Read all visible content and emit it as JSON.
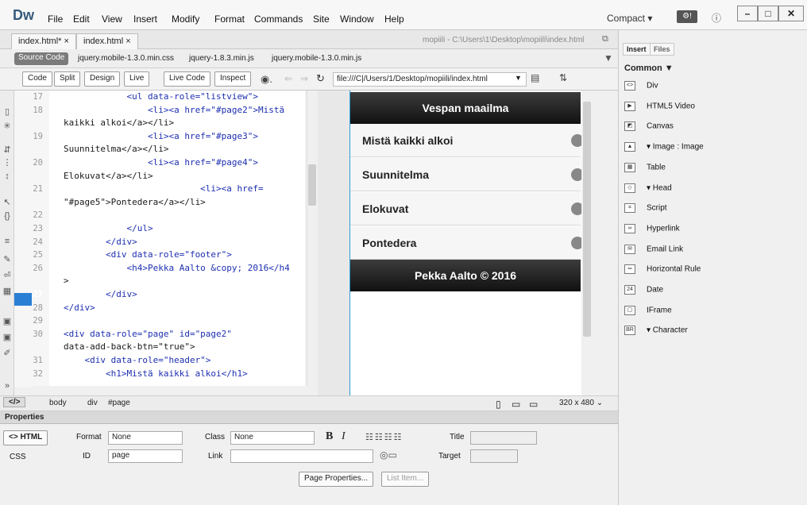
{
  "app": {
    "logo": "Dw",
    "menus": [
      "File",
      "Edit",
      "View",
      "Insert",
      "Modify",
      "Format",
      "Commands",
      "Site",
      "Window",
      "Help"
    ],
    "workspace": "Compact ▾",
    "gear": "⚙"
  },
  "tabs": [
    {
      "label": "index.html*  ×"
    },
    {
      "label": "index.html  ×"
    }
  ],
  "path": "mopiili - C:\\Users\\1\\Desktop\\mopiili\\index.html",
  "related": {
    "source": "Source Code",
    "files": [
      "jquery.mobile-1.3.0.min.css",
      "jquery-1.8.3.min.js",
      "jquery.mobile-1.3.0.min.js"
    ]
  },
  "toolbar": {
    "code": "Code",
    "split": "Split",
    "design": "Design",
    "live": "Live",
    "livecode": "Live Code",
    "inspect": "Inspect",
    "address": "file:///C|/Users/1/Desktop/mopiili/index.html"
  },
  "code": {
    "lines": [
      {
        "n": "17",
        "t": "            <ul data-role=\"listview\">"
      },
      {
        "n": "18",
        "t": "                <li><a href=\"#page2\">Mistä"
      },
      {
        "n": "",
        "t": "kaikki alkoi</a></li>"
      },
      {
        "n": "19",
        "t": "                <li><a href=\"#page3\">"
      },
      {
        "n": "",
        "t": "Suunnitelma</a></li>"
      },
      {
        "n": "20",
        "t": "                <li><a href=\"#page4\">"
      },
      {
        "n": "",
        "t": "Elokuvat</a></li>"
      },
      {
        "n": "21",
        "t": "                          <li><a href="
      },
      {
        "n": "",
        "t": "\"#page5\">Pontedera</a></li>"
      },
      {
        "n": "22",
        "t": ""
      },
      {
        "n": "23",
        "t": "            </ul>"
      },
      {
        "n": "24",
        "t": "        </div>"
      },
      {
        "n": "25",
        "t": "        <div data-role=\"footer\">"
      },
      {
        "n": "26",
        "t": "            <h4>Pekka Aalto &copy; 2016</h4"
      },
      {
        "n": "",
        "t": ">"
      },
      {
        "n": "27",
        "t": "        </div>"
      },
      {
        "n": "28",
        "t": "</div>"
      },
      {
        "n": "29",
        "t": ""
      },
      {
        "n": "30",
        "t": "<div data-role=\"page\" id=\"page2\""
      },
      {
        "n": "",
        "t": "data-add-back-btn=\"true\">"
      },
      {
        "n": "31",
        "t": "    <div data-role=\"header\">"
      },
      {
        "n": "32",
        "t": "        <h1>Mistä kaikki alkoi</h1>"
      }
    ]
  },
  "live": {
    "header": "Vespan maailma",
    "items": [
      "Mistä kaikki alkoi",
      "Suunnitelma",
      "Elokuvat",
      "Pontedera"
    ],
    "footer": "Pekka Aalto © 2016"
  },
  "status": {
    "tag": "</>",
    "crumbs": [
      "body",
      "div",
      "#page"
    ],
    "size": "320 x 480 ⌄"
  },
  "properties": {
    "title": "Properties",
    "html": "<> HTML",
    "css": "CSS",
    "format_label": "Format",
    "format": "None",
    "class_label": "Class",
    "class": "None",
    "id_label": "ID",
    "id": "page",
    "link_label": "Link",
    "title_label": "Title",
    "target_label": "Target",
    "bold": "B",
    "italic": "I",
    "pageprops": "Page Properties...",
    "listitem": "List Item..."
  },
  "panel": {
    "insert": "Insert",
    "files": "Files",
    "category": "Common ▼",
    "items": [
      {
        "icon": "<>",
        "label": "Div"
      },
      {
        "icon": "▶",
        "label": "HTML5 Video"
      },
      {
        "icon": "◩",
        "label": "Canvas"
      },
      {
        "icon": "▲",
        "label": "▾ Image : Image"
      },
      {
        "icon": "▦",
        "label": "Table"
      },
      {
        "icon": "◇",
        "label": "▾ Head"
      },
      {
        "icon": "⌗",
        "label": "Script"
      },
      {
        "icon": "∞",
        "label": "Hyperlink"
      },
      {
        "icon": "✉",
        "label": "Email Link"
      },
      {
        "icon": "═",
        "label": "Horizontal Rule"
      },
      {
        "icon": "24",
        "label": "Date"
      },
      {
        "icon": "▢",
        "label": "IFrame"
      },
      {
        "icon": "BR",
        "label": "▾ Character"
      }
    ]
  }
}
